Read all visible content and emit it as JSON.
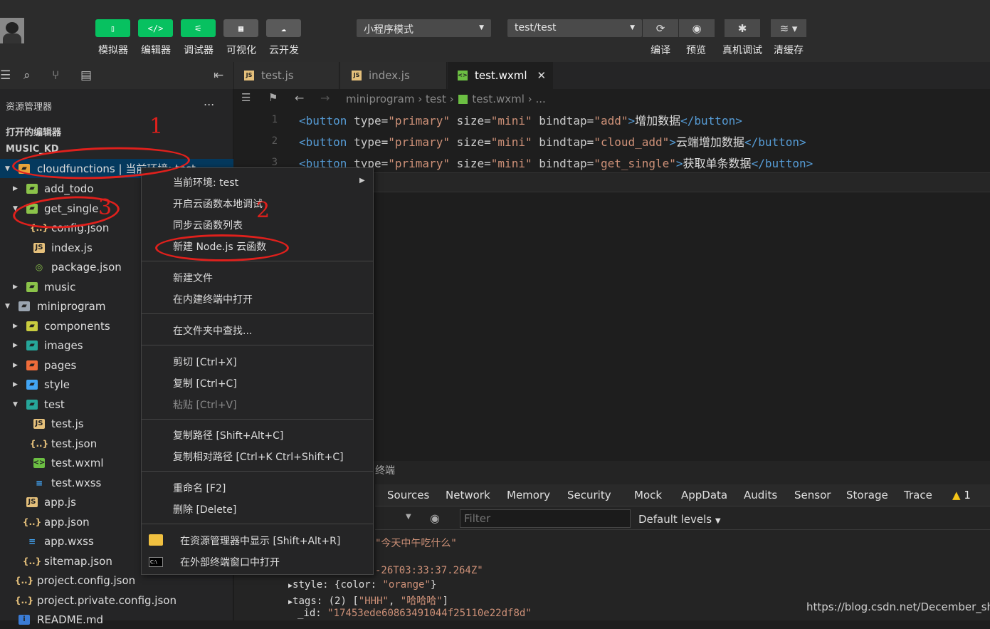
{
  "toolbar": {
    "buttons": [
      {
        "label": "模拟器",
        "glyph": "▯"
      },
      {
        "label": "编辑器",
        "glyph": "</>"
      },
      {
        "label": "调试器",
        "glyph": "⚟"
      },
      {
        "label": "可视化",
        "glyph": "▦"
      },
      {
        "label": "云开发",
        "glyph": "☁"
      }
    ],
    "mode_select": "小程序模式",
    "env_select": "test/test",
    "right_buttons": [
      "编译",
      "预览",
      "真机调试",
      "清缓存"
    ]
  },
  "sidebar": {
    "explorer_title": "资源管理器",
    "more": "...",
    "open_editors": "打开的编辑器",
    "project": "MUSIC_KD",
    "tree": [
      {
        "name": "cloudfunctions | 当前环境: test",
        "type": "cloud-folder"
      },
      {
        "name": "add_todo",
        "type": "cloud-fn"
      },
      {
        "name": "get_single",
        "type": "cloud-fn"
      },
      {
        "name": "config.json",
        "type": "json"
      },
      {
        "name": "index.js",
        "type": "js"
      },
      {
        "name": "package.json",
        "type": "npm"
      },
      {
        "name": "music",
        "type": "cloud-fn"
      },
      {
        "name": "miniprogram",
        "type": "folder"
      },
      {
        "name": "components",
        "type": "comp"
      },
      {
        "name": "images",
        "type": "img"
      },
      {
        "name": "pages",
        "type": "pages"
      },
      {
        "name": "style",
        "type": "style"
      },
      {
        "name": "test",
        "type": "test"
      },
      {
        "name": "test.js",
        "type": "js"
      },
      {
        "name": "test.json",
        "type": "json"
      },
      {
        "name": "test.wxml",
        "type": "wxml"
      },
      {
        "name": "test.wxss",
        "type": "wxss"
      },
      {
        "name": "app.js",
        "type": "js"
      },
      {
        "name": "app.json",
        "type": "json"
      },
      {
        "name": "app.wxss",
        "type": "wxss"
      },
      {
        "name": "sitemap.json",
        "type": "json"
      },
      {
        "name": "project.config.json",
        "type": "json"
      },
      {
        "name": "project.private.config.json",
        "type": "json"
      },
      {
        "name": "README.md",
        "type": "info"
      }
    ]
  },
  "editor": {
    "tabs": [
      "test.js",
      "index.js",
      "test.wxml"
    ],
    "breadcrumb": [
      "miniprogram",
      "test",
      "test.wxml",
      "..."
    ],
    "lines": [
      {
        "n": "1",
        "attrval": "add",
        "text": "增加数据"
      },
      {
        "n": "2",
        "attrval": "cloud_add",
        "text": "云端增加数据"
      },
      {
        "n": "3",
        "attrval": "get_single",
        "text": "获取单条数据"
      }
    ],
    "type_val": "primary",
    "size_val": "mini"
  },
  "console": {
    "panel_title": "终端",
    "tabs": [
      "Sources",
      "Network",
      "Memory",
      "Security",
      "Mock",
      "AppData",
      "Audits",
      "Sensor",
      "Storage",
      "Trace"
    ],
    "warn_count": "1",
    "filter_placeholder": "Filter",
    "levels": "Default levels",
    "log": {
      "l1": "\"今天中午吃什么\"",
      "l2": "-26T03:33:37.264Z\"",
      "style_key": "style:",
      "style_val": "{color: ",
      "style_str": "\"orange\"",
      "tags_key": "tags:",
      "tags_val": "(2) [",
      "tags_s1": "\"HHH\"",
      "tags_s2": "\"哈哈哈\"",
      "id_key": "_id:",
      "id_val": "\"17453ede60863491044f25110e22df8d\""
    }
  },
  "context_menu": [
    {
      "label": "当前环境: test",
      "sub": true
    },
    {
      "label": "开启云函数本地调试"
    },
    {
      "label": "同步云函数列表"
    },
    {
      "label": "新建 Node.js 云函数"
    },
    {
      "label": "新建文件"
    },
    {
      "label": "在内建终端中打开"
    },
    {
      "label": "在文件夹中查找..."
    },
    {
      "label": "剪切   [Ctrl+X]"
    },
    {
      "label": "复制   [Ctrl+C]"
    },
    {
      "label": "粘贴   [Ctrl+V]",
      "disabled": true
    },
    {
      "label": "复制路径   [Shift+Alt+C]"
    },
    {
      "label": "复制相对路径   [Ctrl+K Ctrl+Shift+C]"
    },
    {
      "label": "重命名   [F2]"
    },
    {
      "label": "删除   [Delete]"
    },
    {
      "label": "在资源管理器中显示   [Shift+Alt+R]"
    },
    {
      "label": "在外部终端窗口中打开"
    }
  ],
  "annotations": [
    "1",
    "2",
    "3"
  ],
  "watermark": "https://blog.csdn.net/December_shi"
}
